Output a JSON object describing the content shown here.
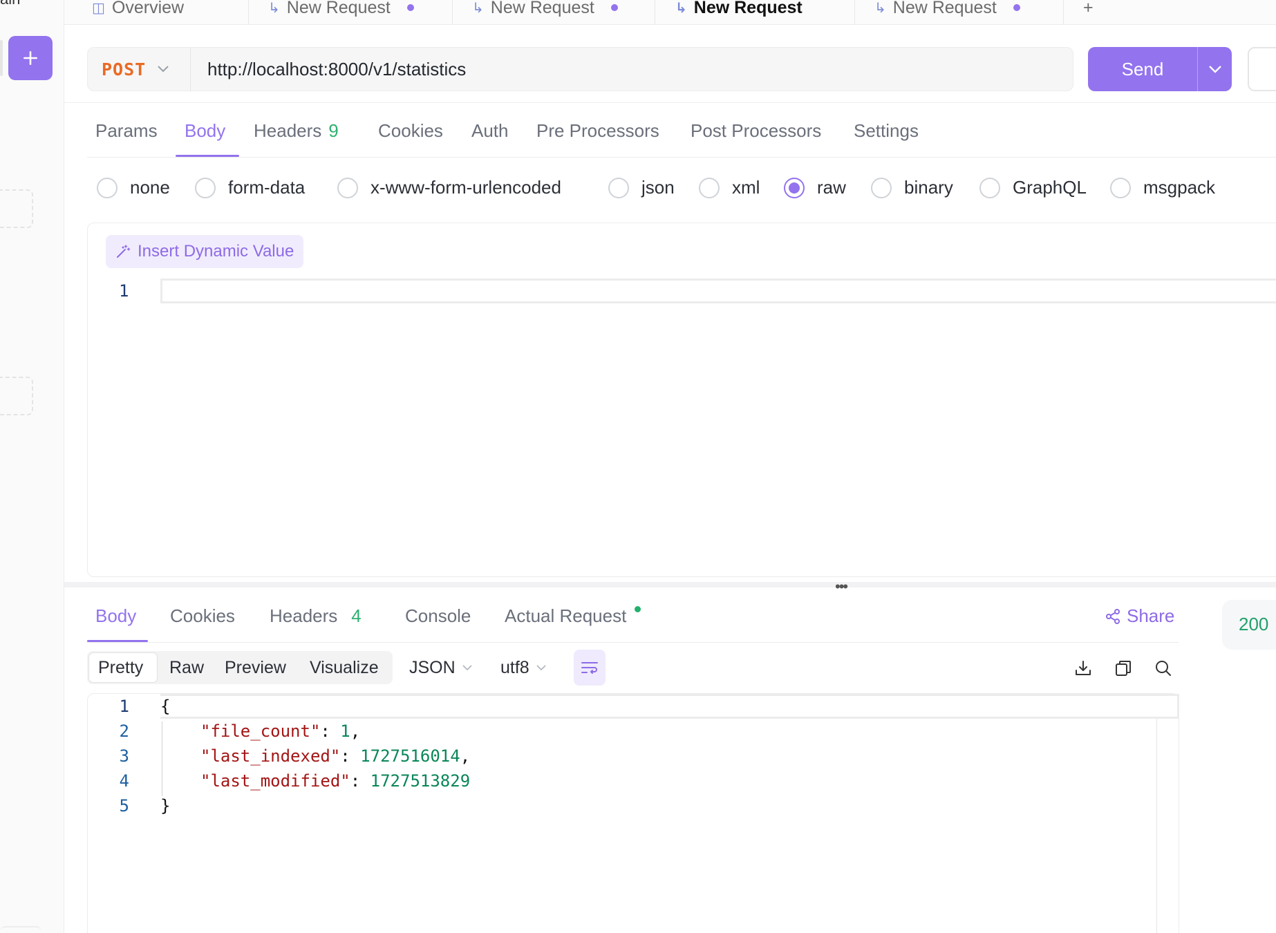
{
  "sidebar": {
    "top_text": "ain"
  },
  "top_tabs": [
    {
      "label": "Overview",
      "icon": "book-icon"
    },
    {
      "label": "New Request",
      "icon": "request-icon",
      "modified": true
    },
    {
      "label": "New Request",
      "icon": "request-icon",
      "modified": true
    },
    {
      "label": "New Request",
      "icon": "request-icon",
      "active": true
    },
    {
      "label": "New Request",
      "icon": "request-icon",
      "modified": true
    }
  ],
  "request": {
    "method": "POST",
    "url": "http://localhost:8000/v1/statistics",
    "send_label": "Send"
  },
  "request_tabs": {
    "params": "Params",
    "body": "Body",
    "headers": "Headers",
    "headers_count": "9",
    "cookies": "Cookies",
    "auth": "Auth",
    "pre": "Pre Processors",
    "post": "Post Processors",
    "settings": "Settings"
  },
  "body_types": {
    "none": "none",
    "form_data": "form-data",
    "urlencoded": "x-www-form-urlencoded",
    "json": "json",
    "xml": "xml",
    "raw": "raw",
    "binary": "binary",
    "graphql": "GraphQL",
    "msgpack": "msgpack",
    "selected": "raw"
  },
  "editor": {
    "insert_label": "Insert Dynamic Value",
    "line1": "1"
  },
  "response_tabs": {
    "body": "Body",
    "cookies": "Cookies",
    "headers": "Headers",
    "headers_count": "4",
    "console": "Console",
    "actual": "Actual Request",
    "share": "Share"
  },
  "status": {
    "code": "200"
  },
  "view": {
    "pretty": "Pretty",
    "raw": "Raw",
    "preview": "Preview",
    "visualize": "Visualize",
    "format": "JSON",
    "encoding": "utf8"
  },
  "response_code": {
    "lines": [
      "1",
      "2",
      "3",
      "4",
      "5"
    ],
    "open": "{",
    "close": "}",
    "fields": [
      {
        "key": "\"file_count\"",
        "value": "1",
        "trail": ","
      },
      {
        "key": "\"last_indexed\"",
        "value": "1727516014",
        "trail": ","
      },
      {
        "key": "\"last_modified\"",
        "value": "1727513829",
        "trail": ""
      }
    ]
  },
  "colors": {
    "accent": "#9373ee",
    "method": "#ea6a24",
    "success": "#22a06b",
    "json_key": "#a31515",
    "json_number": "#098658"
  }
}
